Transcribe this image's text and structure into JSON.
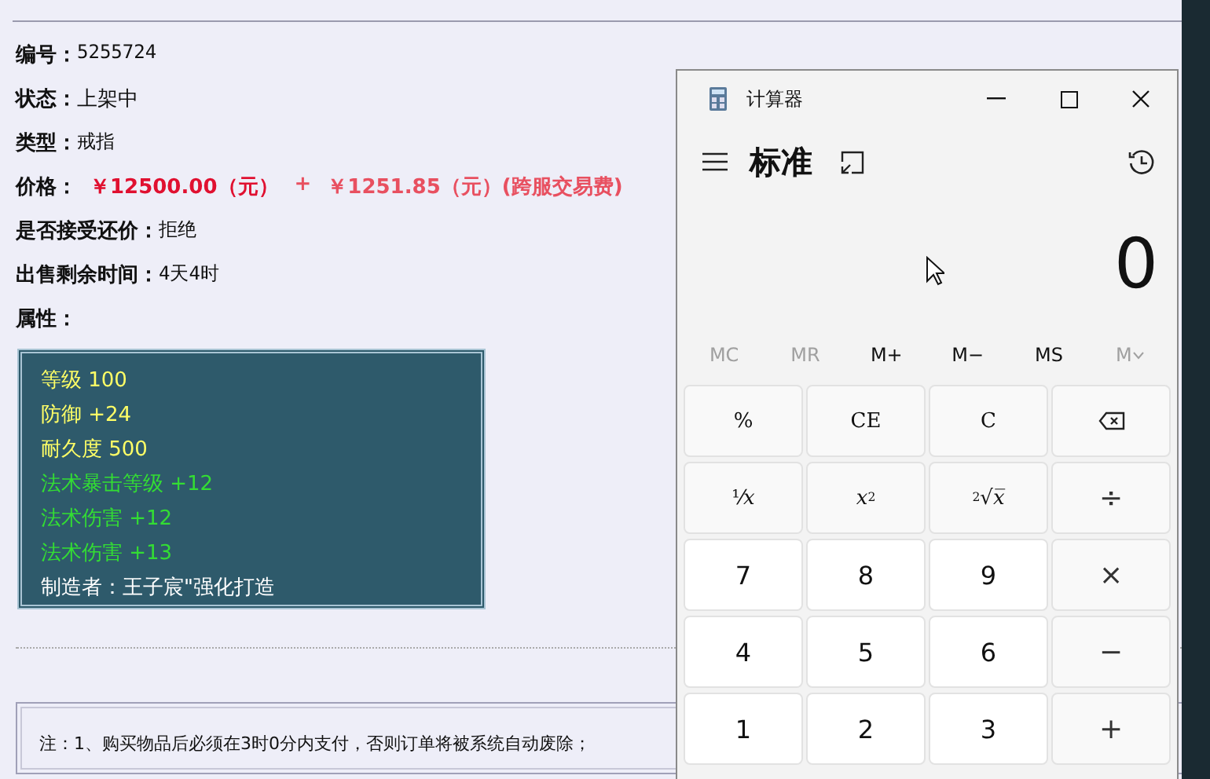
{
  "item_details": {
    "fields": [
      {
        "label": "编号：",
        "value": "5255724"
      },
      {
        "label": "状态：",
        "value": " 上架中"
      },
      {
        "label": "类型：",
        "value": "戒指"
      },
      {
        "label": "价格：",
        "kind": "price",
        "price": "￥12500.00（元）",
        "plus": "+",
        "fee": "￥1251.85（元）(跨服交易费)"
      },
      {
        "label": "是否接受还价：",
        "value": "拒绝"
      },
      {
        "label": "出售剩余时间：",
        "value": "4天4时"
      },
      {
        "label": "属性："
      }
    ],
    "attributes": [
      {
        "text": "等级 100",
        "color": "#ffff66"
      },
      {
        "text": "防御 +24",
        "color": "#ffff66"
      },
      {
        "text": "耐久度 500",
        "color": "#ffff66"
      },
      {
        "text": "法术暴击等级 +12",
        "color": "#33dd33"
      },
      {
        "text": "法术伤害 +12",
        "color": "#33dd33"
      },
      {
        "text": "法术伤害 +13",
        "color": "#33dd33"
      },
      {
        "text": "制造者：王子宸\"强化打造",
        "color": "#ffffff"
      }
    ],
    "note": "注：1、购买物品后必须在3时0分内支付，否则订单将被系统自动废除；"
  },
  "calculator": {
    "title": "计算器",
    "mode": "标准",
    "display": "0",
    "memory": [
      {
        "label": "MC",
        "disabled": true
      },
      {
        "label": "MR",
        "disabled": true
      },
      {
        "label": "M+",
        "disabled": false
      },
      {
        "label": "M−",
        "disabled": false
      },
      {
        "label": "MS",
        "disabled": false
      },
      {
        "label": "M",
        "disabled": true,
        "kind": "dropdown"
      }
    ],
    "keys": [
      {
        "label": "%",
        "kind": "function"
      },
      {
        "label": "CE",
        "kind": "function"
      },
      {
        "label": "C",
        "kind": "function"
      },
      {
        "kind": "backspace"
      },
      {
        "label": "¹⁄*x*",
        "kind": "function"
      },
      {
        "label": "*x*$^{2}$",
        "kind": "function"
      },
      {
        "label": "$^{2}$√*x̅*",
        "kind": "function"
      },
      {
        "label": "÷",
        "kind": "operator"
      },
      {
        "label": "7",
        "kind": "digit"
      },
      {
        "label": "8",
        "kind": "digit"
      },
      {
        "label": "9",
        "kind": "digit"
      },
      {
        "label": "×",
        "kind": "operator"
      },
      {
        "label": "4",
        "kind": "digit"
      },
      {
        "label": "5",
        "kind": "digit"
      },
      {
        "label": "6",
        "kind": "digit"
      },
      {
        "label": "−",
        "kind": "operator"
      },
      {
        "label": "1",
        "kind": "digit"
      },
      {
        "label": "2",
        "kind": "digit"
      },
      {
        "label": "3",
        "kind": "digit"
      },
      {
        "label": "+",
        "kind": "operator"
      }
    ]
  }
}
